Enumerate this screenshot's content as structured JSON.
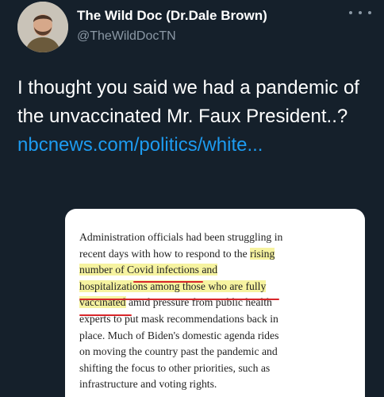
{
  "author": {
    "display_name": "The Wild Doc (Dr.Dale Brown)",
    "handle": "@TheWildDocTN"
  },
  "header": {
    "more_icon": "more-horizontal-icon"
  },
  "tweet": {
    "text": "I thought you said we had a pandemic of the unvaccinated Mr. Faux President..? ",
    "link_text": "nbcnews.com/politics/white..."
  },
  "article": {
    "lines": [
      "Administration officials had been struggling in",
      "recent days with how to respond to the ",
      "rising",
      "number of Covid infections and",
      "hospitalizations among those who are fully",
      "vaccinated",
      " amid pressure from public health",
      "experts to put mask recommendations back in",
      "place. Much of Biden's domestic agenda rides",
      "on moving the country past the pandemic and",
      "shifting the focus to other priorities, such as",
      "infrastructure and voting rights."
    ]
  },
  "colors": {
    "background": "#15202b",
    "link": "#1d9bf0",
    "highlight": "#f6f3a0",
    "underline": "#d8262a"
  }
}
